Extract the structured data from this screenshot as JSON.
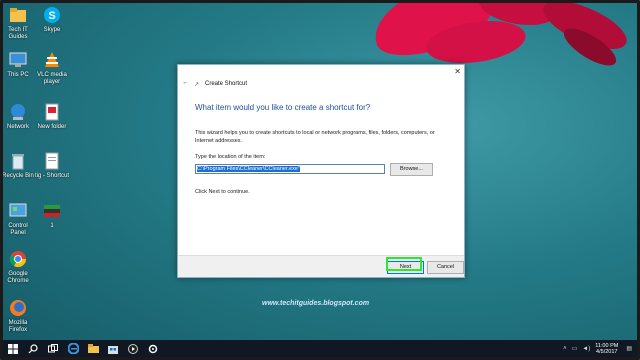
{
  "desktop": {
    "icons": [
      {
        "label": "Tech IT Guides",
        "icon": "folder-icon"
      },
      {
        "label": "Skype",
        "icon": "skype-icon"
      },
      {
        "label": "This PC",
        "icon": "this-pc-icon"
      },
      {
        "label": "VLC media player",
        "icon": "vlc-icon"
      },
      {
        "label": "Network",
        "icon": "network-icon"
      },
      {
        "label": "New folder",
        "icon": "folder-icon"
      },
      {
        "label": "Recycle Bin",
        "icon": "recycle-bin-icon"
      },
      {
        "label": "tig - Shortcut",
        "icon": "document-shortcut-icon"
      },
      {
        "label": "Control Panel",
        "icon": "control-panel-icon"
      },
      {
        "label": "1",
        "icon": "image-file-icon"
      },
      {
        "label": "Google Chrome",
        "icon": "chrome-icon"
      },
      {
        "label": "Mozilla Firefox",
        "icon": "firefox-icon"
      }
    ]
  },
  "dialog": {
    "title": "Create Shortcut",
    "heading": "What item would you like to create a shortcut for?",
    "description": "This wizard helps you to create shortcuts to local or network programs, files, folders, computers, or Internet addresses.",
    "location_label": "Type the location of the item:",
    "location_value": "C:\\Program Files\\CCleaner\\CCleaner.exe\"",
    "browse_label": "Browse...",
    "hint": "Click Next to continue.",
    "next_label": "Next",
    "cancel_label": "Cancel"
  },
  "watermark": "www.techitguides.blogspot.com",
  "taskbar": {
    "items": [
      "start-icon",
      "search-icon",
      "task-view-icon",
      "edge-icon",
      "file-explorer-icon",
      "store-icon",
      "media-icon",
      "settings-icon"
    ],
    "time": "11:00 PM",
    "date": "4/5/2017"
  },
  "colors": {
    "accent": "#0078d7",
    "highlight": "#2ee82e",
    "heading": "#1e4f9c"
  }
}
